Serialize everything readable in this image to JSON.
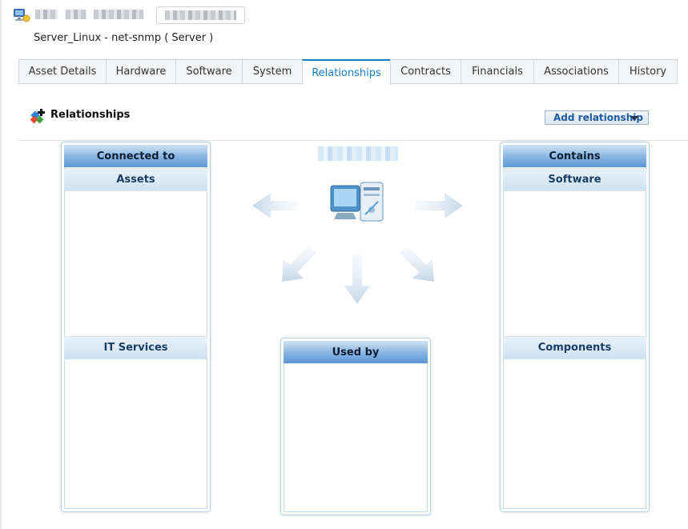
{
  "header": {
    "subtitle": "Server_Linux - net-snmp ( Server )"
  },
  "tabs": [
    {
      "label": "Asset Details",
      "active": false
    },
    {
      "label": "Hardware",
      "active": false
    },
    {
      "label": "Software",
      "active": false
    },
    {
      "label": "System",
      "active": false
    },
    {
      "label": "Relationships",
      "active": true
    },
    {
      "label": "Contracts",
      "active": false
    },
    {
      "label": "Financials",
      "active": false
    },
    {
      "label": "Associations",
      "active": false
    },
    {
      "label": "History",
      "active": false
    }
  ],
  "section": {
    "title": "Relationships",
    "add_button_label": "Add relationship"
  },
  "panels": {
    "connected_to": {
      "title": "Connected to",
      "sub1": "Assets",
      "sub2": "IT Services"
    },
    "contains": {
      "title": "Contains",
      "sub1": "Software",
      "sub2": "Components"
    },
    "used_by": {
      "title": "Used by"
    }
  },
  "colors": {
    "accent": "#1a7cc7",
    "panel_header": "#5d97d6",
    "button_text": "#1f5aa0"
  },
  "icons": {
    "asset": "server-asset-icon",
    "relationships": "relationships-icon",
    "computer": "computer-icon",
    "dropdown": "caret-down-icon"
  }
}
